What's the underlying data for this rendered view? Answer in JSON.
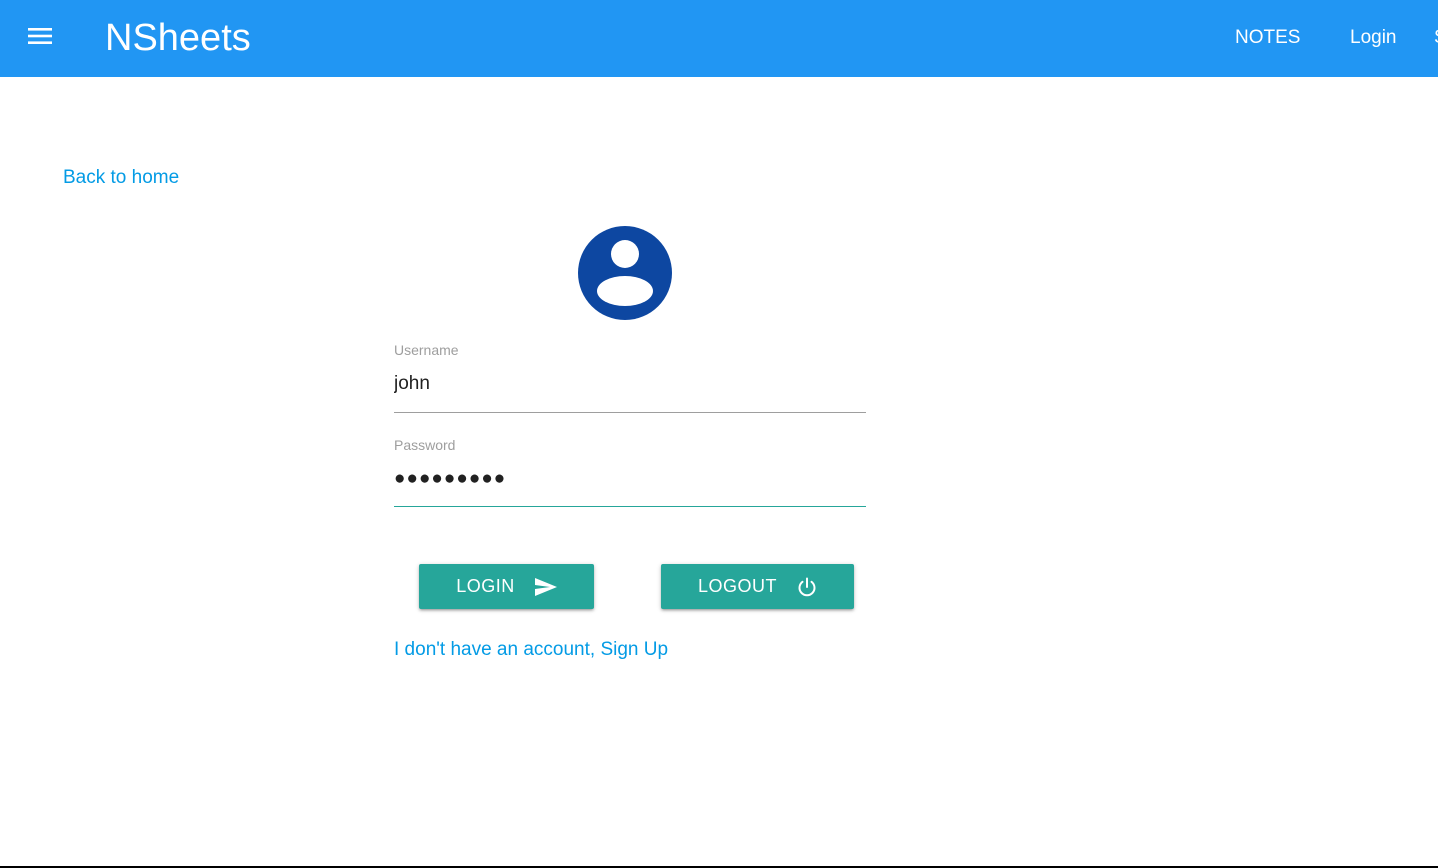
{
  "navbar": {
    "brand": "NSheets",
    "menu_icon": "hamburger-menu-icon",
    "links": {
      "notes": "NOTES",
      "login": "Login",
      "signup_partial": "S"
    },
    "color": "#2196f3"
  },
  "back_link": "Back to home",
  "avatar_icon": "account-circle-icon",
  "form": {
    "username_label": "Username",
    "username_value": "john",
    "password_label": "Password",
    "password_value": "●●●●●●●●●"
  },
  "buttons": {
    "login_label": "LOGIN",
    "login_icon": "send-icon",
    "logout_label": "LOGOUT",
    "logout_icon": "power-icon",
    "color": "#26a69a"
  },
  "signup_link": "I don't have an account, Sign Up",
  "link_color": "#039be5"
}
